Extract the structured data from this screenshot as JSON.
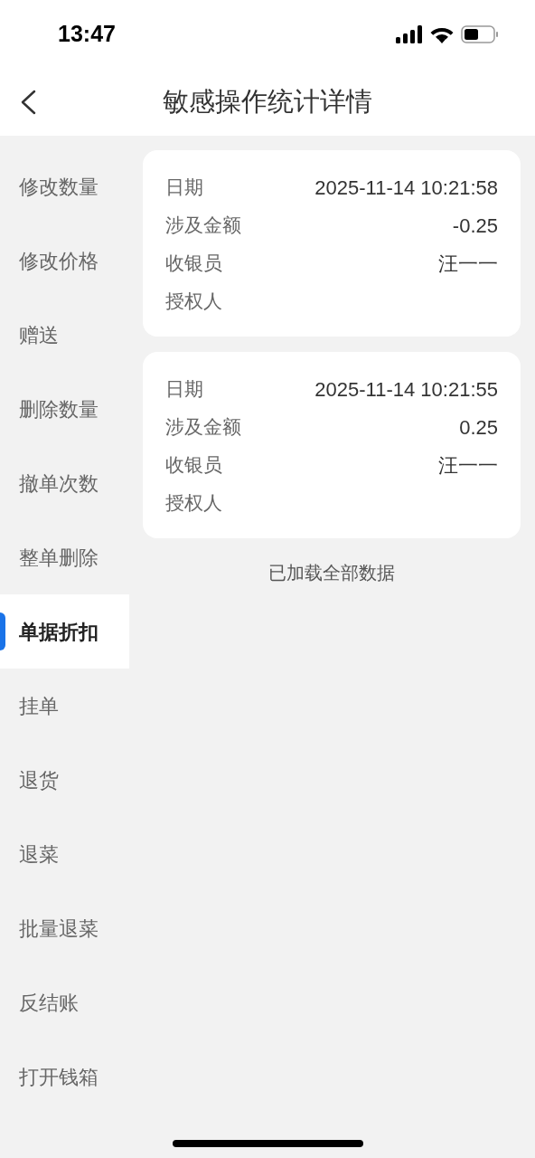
{
  "status_bar": {
    "time": "13:47"
  },
  "header": {
    "title": "敏感操作统计详情"
  },
  "sidebar": {
    "items": [
      {
        "label": "修改数量",
        "selected": false
      },
      {
        "label": "修改价格",
        "selected": false
      },
      {
        "label": "赠送",
        "selected": false
      },
      {
        "label": "删除数量",
        "selected": false
      },
      {
        "label": "撤单次数",
        "selected": false
      },
      {
        "label": "整单删除",
        "selected": false
      },
      {
        "label": "单据折扣",
        "selected": true
      },
      {
        "label": "挂单",
        "selected": false
      },
      {
        "label": "退货",
        "selected": false
      },
      {
        "label": "退菜",
        "selected": false
      },
      {
        "label": "批量退菜",
        "selected": false
      },
      {
        "label": "反结账",
        "selected": false
      },
      {
        "label": "打开钱箱",
        "selected": false
      }
    ]
  },
  "records": [
    {
      "fields": [
        {
          "label": "日期",
          "value": "2025-11-14 10:21:58"
        },
        {
          "label": "涉及金额",
          "value": "-0.25"
        },
        {
          "label": "收银员",
          "value": "汪一一"
        },
        {
          "label": "授权人"
        }
      ]
    },
    {
      "fields": [
        {
          "label": "日期",
          "value": "2025-11-14 10:21:55"
        },
        {
          "label": "涉及金额",
          "value": "0.25"
        },
        {
          "label": "收银员",
          "value": "汪一一"
        },
        {
          "label": "授权人"
        }
      ]
    }
  ],
  "footer_note": "已加载全部数据"
}
